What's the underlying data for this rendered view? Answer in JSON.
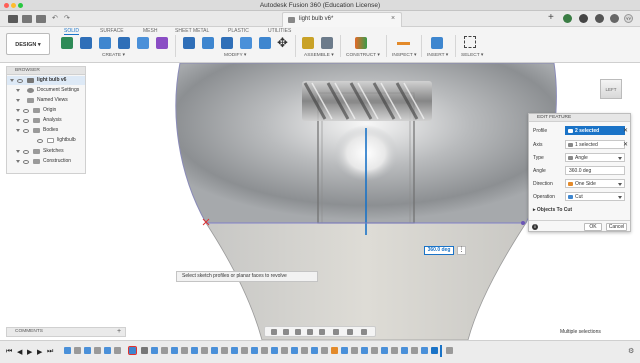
{
  "app": {
    "window_title": "Autodesk Fusion 360 (Education License)",
    "doc_tab": "light bulb v6*"
  },
  "toolbar": {
    "workspace_button": "DESIGN",
    "tabs": [
      "SOLID",
      "SURFACE",
      "MESH",
      "SHEET METAL",
      "PLASTIC",
      "UTILITIES"
    ],
    "active_tab": "SOLID",
    "groups": [
      "CREATE",
      "MODIFY",
      "ASSEMBLE",
      "CONSTRUCT",
      "INSPECT",
      "INSERT",
      "SELECT"
    ]
  },
  "browser": {
    "header": "BROWSER",
    "items": [
      {
        "label": "light bulb v6"
      },
      {
        "label": "Document Settings"
      },
      {
        "label": "Named Views"
      },
      {
        "label": "Origin"
      },
      {
        "label": "Analysis"
      },
      {
        "label": "Bodies"
      },
      {
        "label": "lightbulb"
      },
      {
        "label": "Sketches"
      },
      {
        "label": "Construction"
      }
    ]
  },
  "edit_feature": {
    "header": "EDIT FEATURE",
    "rows": [
      {
        "label": "Profile",
        "value": "2 selected"
      },
      {
        "label": "Axis",
        "value": "1 selected"
      },
      {
        "label": "Type",
        "value": "Angle"
      },
      {
        "label": "Angle",
        "value": "360.0 deg"
      },
      {
        "label": "Direction",
        "value": "One Side"
      },
      {
        "label": "Operation",
        "value": "Cut"
      }
    ],
    "section": "Objects To Cut",
    "ok": "OK",
    "cancel": "Cancel"
  },
  "viewport": {
    "viewcube_label": "LEFT",
    "angle_input": "360.0 deg",
    "tooltip": "Select sketch profiles or planar faces to revolve"
  },
  "comments": {
    "label": "COMMENTS"
  },
  "status": {
    "right": "Multiple selections"
  },
  "colors": {
    "accent": "#1a73c7",
    "highlight": "#e0322f"
  }
}
